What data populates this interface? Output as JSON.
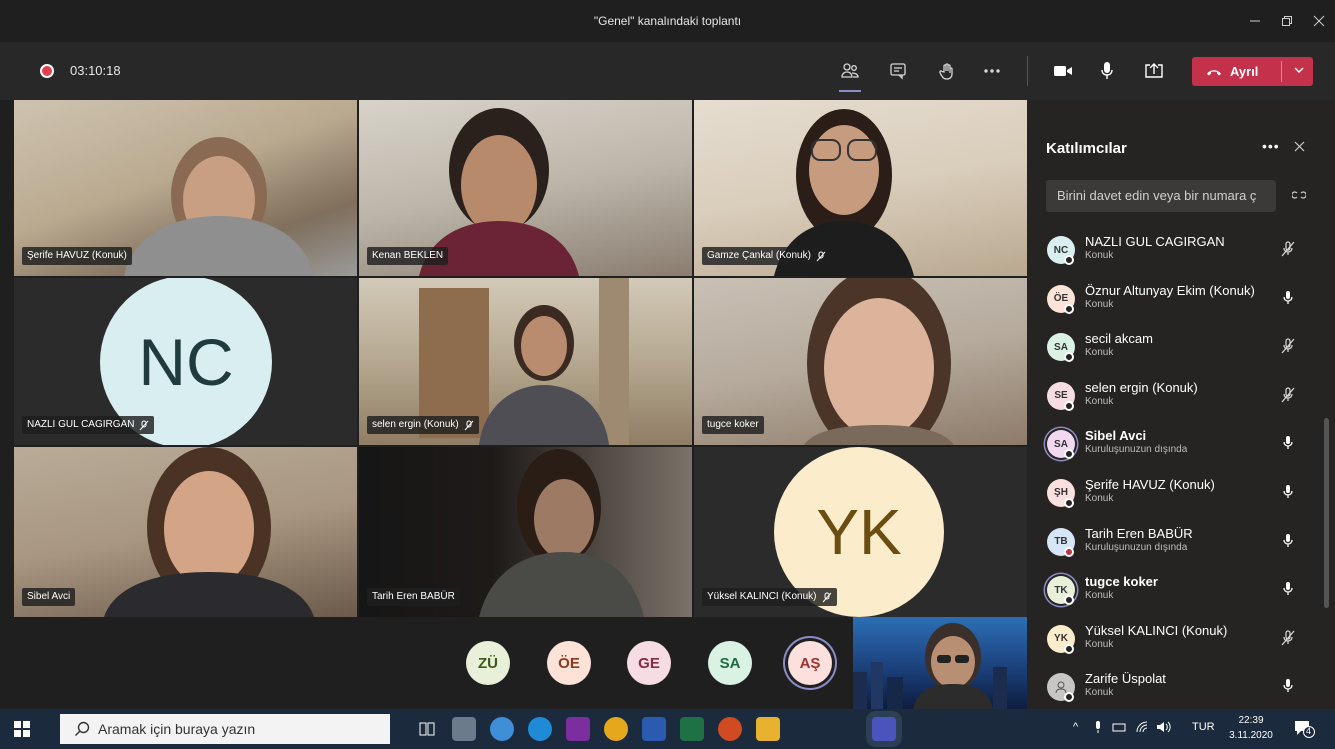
{
  "window": {
    "title": "\"Genel\" kanalındaki toplantı",
    "controls": [
      "minimize-icon",
      "maximize-icon",
      "close-icon"
    ]
  },
  "toolbar": {
    "timer": "03:10:18",
    "icons": [
      "participants-icon",
      "chat-icon",
      "raise-hand-icon",
      "more-icon",
      "camera-icon",
      "mic-icon",
      "share-screen-icon"
    ],
    "leave_label": "Ayrıl",
    "leave_color": "#c4314b"
  },
  "tiles": [
    {
      "name": "Şerife HAVUZ (Konuk)",
      "muted": false
    },
    {
      "name": "Kenan BEKLEN",
      "muted": false
    },
    {
      "name": "Gamze Çankal (Konuk)",
      "muted": true
    },
    {
      "name": "NAZLI GUL CAGIRGAN",
      "muted": true,
      "initials": "NC"
    },
    {
      "name": "selen ergin (Konuk)",
      "muted": true
    },
    {
      "name": "tugce koker",
      "muted": false
    },
    {
      "name": "Sibel Avci",
      "muted": false
    },
    {
      "name": "Tarih Eren BABÜR",
      "muted": false
    },
    {
      "name": "Yüksel KALINCI (Konuk)",
      "muted": true,
      "initials": "YK"
    }
  ],
  "overflow_avatars": [
    "ZÜ",
    "ÖE",
    "GE",
    "SA",
    "AŞ"
  ],
  "panel": {
    "title": "Katılımcılar",
    "invite_placeholder": "Birini davet edin veya bir numara ç",
    "participants": [
      {
        "initials": "NC",
        "name": "NAZLI GUL CAGIRGAN",
        "sub": "Konuk",
        "mic": "muted",
        "bold": false
      },
      {
        "initials": "ÖE",
        "name": "Öznur Altunyay Ekim (Konuk)",
        "sub": "Konuk",
        "mic": "on",
        "bold": false
      },
      {
        "initials": "SA",
        "name": "secil akcam",
        "sub": "Konuk",
        "mic": "muted",
        "bold": false
      },
      {
        "initials": "SE",
        "name": "selen ergin (Konuk)",
        "sub": "Konuk",
        "mic": "muted",
        "bold": false
      },
      {
        "initials": "SA",
        "name": "Sibel Avci",
        "sub": "Kuruluşunuzun dışında",
        "mic": "on",
        "bold": true
      },
      {
        "initials": "ŞH",
        "name": "Şerife HAVUZ (Konuk)",
        "sub": "Konuk",
        "mic": "on",
        "bold": false
      },
      {
        "initials": "TB",
        "name": "Tarih Eren BABÜR",
        "sub": "Kuruluşunuzun dışında",
        "mic": "on",
        "bold": false
      },
      {
        "initials": "TK",
        "name": "tugce koker",
        "sub": "Konuk",
        "mic": "on",
        "bold": true
      },
      {
        "initials": "YK",
        "name": "Yüksel KALINCI (Konuk)",
        "sub": "Konuk",
        "mic": "muted",
        "bold": false
      },
      {
        "initials": "",
        "name": "Zarife Üspolat",
        "sub": "Konuk",
        "mic": "on",
        "bold": false
      }
    ]
  },
  "taskbar": {
    "search_placeholder": "Aramak için buraya yazın",
    "lang": "TUR",
    "time": "22:39",
    "date": "3.11.2020",
    "notifications": "4"
  }
}
